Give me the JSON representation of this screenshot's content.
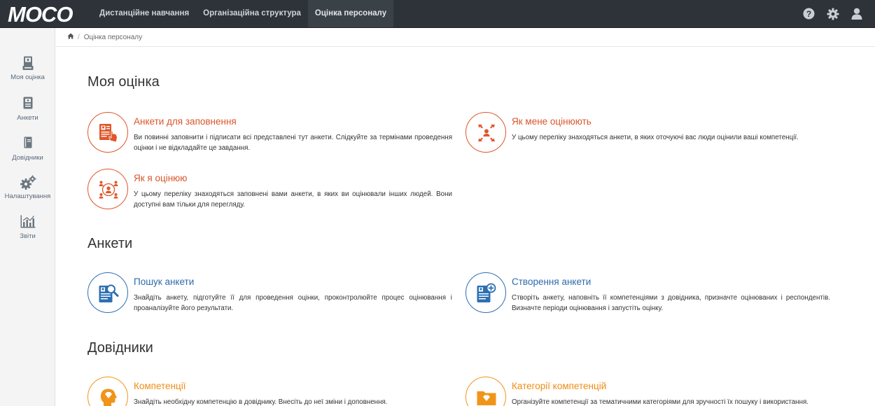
{
  "app": {
    "logo_text": "MOCO"
  },
  "topnav": {
    "items": [
      {
        "label": "Дистанційне навчання"
      },
      {
        "label": "Організаційна структура"
      },
      {
        "label": "Оцінка персоналу"
      }
    ],
    "active": "Оцінка персоналу",
    "icons": [
      "help-icon",
      "settings-icon",
      "user-icon"
    ]
  },
  "sidebar": {
    "items": [
      {
        "label": "Моя оцінка",
        "icon": "my-evaluation-icon"
      },
      {
        "label": "Анкети",
        "icon": "questionnaire-icon"
      },
      {
        "label": "Довідники",
        "icon": "book-icon"
      },
      {
        "label": "Налаштування",
        "icon": "gears-icon"
      },
      {
        "label": "Звіти",
        "icon": "chart-icon"
      }
    ]
  },
  "breadcrumb": {
    "home_icon": "home-icon",
    "current": "Оцінка персоналу"
  },
  "sections": {
    "my": {
      "title": "Моя оцінка",
      "cards": [
        {
          "title": "Анкети для заповнення",
          "desc": "Ви повинні заповнити і підписати всі представлені тут анкети. Слідкуйте за термінами проведення оцінки і не відкладайте це завдання.",
          "icon": "fill-form-icon"
        },
        {
          "title": "Як мене оцінюють",
          "desc": "У цьому переліку знаходяться анкети, в яких оточуючі вас люди оцінили ваші компетенції.",
          "icon": "people-inward-icon"
        },
        {
          "title": "Як я оцінюю",
          "desc": "У цьому переліку знаходяться заповнені вами анкети, в яких ви оцінювали інших людей. Вони доступні вам тільки для перегляду.",
          "icon": "people-outward-icon"
        }
      ]
    },
    "forms": {
      "title": "Анкети",
      "cards": [
        {
          "title": "Пошук анкети",
          "desc": "Знайдіть анкету, підготуйте її для проведення оцінки, проконтролюйте процес оцінювання і проаналізуйте його результати.",
          "icon": "search-form-icon"
        },
        {
          "title": "Створення анкети",
          "desc": "Створіть анкету, наповніть її компетенціями з довідника, призначте оцінюваних і респондентів. Визначте періоди оцінювання і запустіть оцінку.",
          "icon": "add-form-icon"
        }
      ]
    },
    "refs": {
      "title": "Довідники",
      "cards": [
        {
          "title": "Компетенції",
          "desc": "Знайдіть необхідну компетенцію в довіднику. Внесіть до неї зміни і доповнення.",
          "icon": "head-diamond-icon"
        },
        {
          "title": "Категорії компетенцій",
          "desc": "Організуйте компетенції за тематичними категоріями для зручності їх пошуку і використання.",
          "icon": "folder-diamond-icon"
        }
      ]
    }
  },
  "colors": {
    "topbar": "#2d3339",
    "orange": "#e0562a",
    "blue": "#2d6fb3",
    "amber": "#f0951a"
  }
}
